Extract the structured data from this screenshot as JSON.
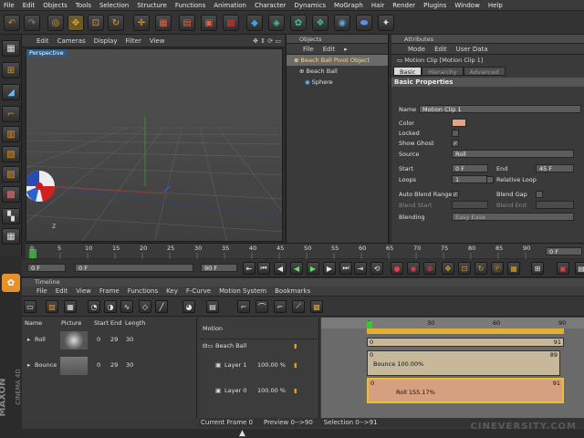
{
  "menubar": [
    "File",
    "Edit",
    "Objects",
    "Tools",
    "Selection",
    "Structure",
    "Functions",
    "Animation",
    "Character",
    "Dynamics",
    "MoGraph",
    "Hair",
    "Render",
    "Plugins",
    "Window",
    "Help"
  ],
  "viewport": {
    "menu": [
      "Edit",
      "Cameras",
      "Display",
      "Filter",
      "View"
    ],
    "label": "Perspective"
  },
  "objects": {
    "header": "Objects",
    "menu": [
      "File",
      "Edit",
      "▸"
    ],
    "items": [
      "Beach Ball Pivot Object",
      "Beach Ball",
      "Sphere"
    ]
  },
  "attributes": {
    "header": "Attributes",
    "menu": [
      "Mode",
      "Edit",
      "User Data"
    ],
    "title": "Motion Clip [Motion Clip 1]",
    "tabs": [
      "Basic",
      "Hierarchy",
      "Advanced"
    ],
    "section": "Basic Properties",
    "name_label": "Name",
    "name_value": "Motion Clip 1",
    "color_label": "Color",
    "color_value": "#e8a080",
    "locked_label": "Locked",
    "show_ghost_label": "Show Ghost",
    "source_label": "Source",
    "source_value": "Roll",
    "start_label": "Start",
    "start_value": "0 F",
    "end_label": "End",
    "end_value": "45 F",
    "loops_label": "Loops",
    "loops_value": "1",
    "relative_loop_label": "Relative Loop",
    "auto_blend_label": "Auto Blend Range",
    "blend_gap_label": "Blend Gap",
    "blend_start_label": "Blend Start",
    "blend_end_label": "Blend End",
    "blending_label": "Blending",
    "blending_value": "Easy Ease"
  },
  "timeline_ruler": {
    "ticks": [
      "0",
      "5",
      "10",
      "15",
      "20",
      "25",
      "30",
      "35",
      "40",
      "45",
      "50",
      "55",
      "60",
      "65",
      "70",
      "75",
      "80",
      "85",
      "90"
    ],
    "end_label": "0 F"
  },
  "transport": {
    "current": "0 F",
    "start": "0 F",
    "end": "90 F"
  },
  "timeline_window": {
    "title": "Timeline",
    "menu": [
      "File",
      "Edit",
      "View",
      "Frame",
      "Functions",
      "Key",
      "F-Curve",
      "Motion System",
      "Bookmarks"
    ],
    "columns": [
      "Name",
      "Picture",
      "Start",
      "End",
      "Length"
    ],
    "sources": [
      {
        "name": "Roll",
        "start": "0",
        "end": "29",
        "length": "30"
      },
      {
        "name": "Bounce",
        "start": "0",
        "end": "29",
        "length": "30"
      }
    ],
    "motion_header": "Motion",
    "tree": [
      {
        "label": "Beach Ball"
      },
      {
        "label": "Layer 1",
        "pct": "100.00 %"
      },
      {
        "label": "Layer 0",
        "pct": "100.00 %"
      }
    ],
    "ruler": [
      "0",
      "30",
      "60",
      "90"
    ],
    "tracks": [
      {
        "start": "0",
        "end": "91",
        "label": ""
      },
      {
        "start": "0",
        "end": "89",
        "label": "Bounce  100.00%"
      },
      {
        "start": "0",
        "end": "91",
        "label": "Roll  155.17%"
      }
    ],
    "status": {
      "current": "Current Frame  0",
      "preview": "Preview  0-->90",
      "selection": "Selection 0-->91"
    }
  },
  "brand": {
    "maxon": "MAXON",
    "cinema": "CINEMA 4D",
    "watermark": "CINEVERSITY.COM"
  }
}
